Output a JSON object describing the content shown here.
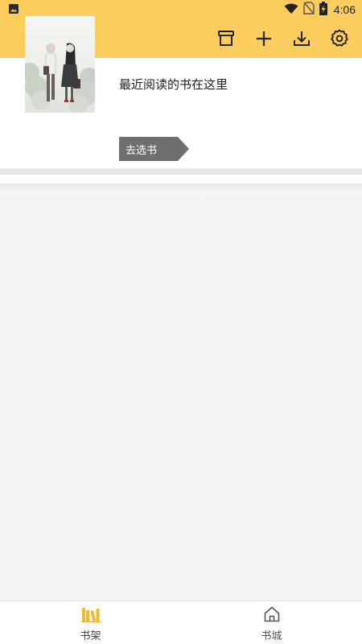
{
  "status_bar": {
    "time": "4:06",
    "icons": [
      "gallery-notification-icon",
      "wifi-icon",
      "no-sim-icon",
      "battery-charging-icon"
    ]
  },
  "toolbar": {
    "actions": [
      {
        "name": "archive-box-icon"
      },
      {
        "name": "add-icon"
      },
      {
        "name": "download-icon"
      },
      {
        "name": "settings-gear-icon"
      }
    ]
  },
  "recent": {
    "title": "最近阅读的书在这里",
    "choose_label": "去选书"
  },
  "bottom_nav": {
    "items": [
      {
        "label": "书架",
        "icon": "bookshelf-icon",
        "active": true
      },
      {
        "label": "书城",
        "icon": "home-icon",
        "active": false
      }
    ]
  },
  "colors": {
    "accent": "#fbcd5d",
    "nav_active": "#f5b72c",
    "choose_button": "#6f6f6f",
    "background": "#f3f3f3"
  }
}
